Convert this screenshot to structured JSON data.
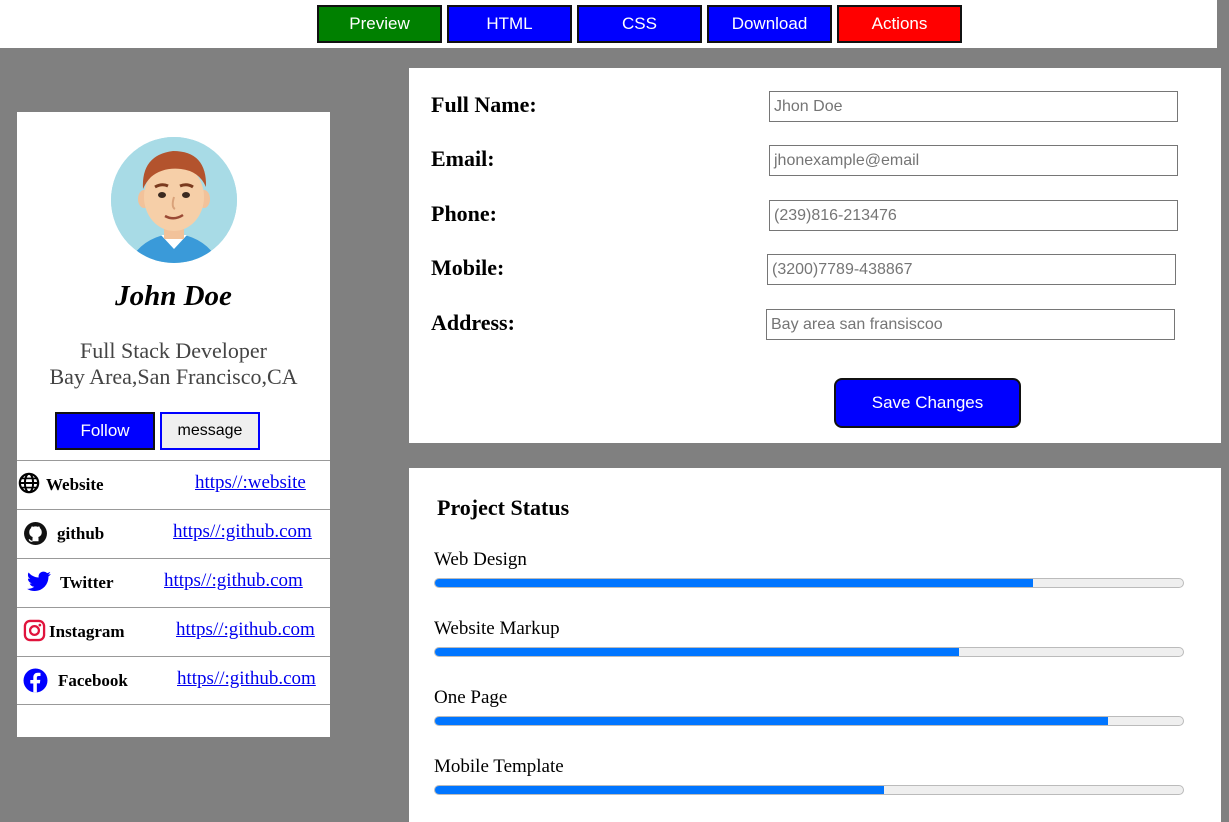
{
  "toolbar": {
    "buttons": [
      {
        "label": "Preview",
        "color": "#008000"
      },
      {
        "label": "HTML",
        "color": "#0000ff"
      },
      {
        "label": "CSS",
        "color": "#0000ff"
      },
      {
        "label": "Download",
        "color": "#0000ff"
      },
      {
        "label": "Actions",
        "color": "#ff0000"
      }
    ]
  },
  "profile": {
    "name": "John Doe",
    "role": "Full Stack Developer",
    "location": "Bay Area,San Francisco,CA",
    "follow_label": "Follow",
    "message_label": "message",
    "links": [
      {
        "label": "Website",
        "url": "https//:website",
        "icon": "globe-icon"
      },
      {
        "label": "github",
        "url": "https//:github.com",
        "icon": "github-icon"
      },
      {
        "label": "Twitter",
        "url": "https//:github.com",
        "icon": "twitter-icon"
      },
      {
        "label": "Instagram",
        "url": "https//:github.com",
        "icon": "instagram-icon"
      },
      {
        "label": "Facebook",
        "url": "https//:github.com",
        "icon": "facebook-icon"
      }
    ]
  },
  "form": {
    "fields": [
      {
        "label": "Full Name:",
        "placeholder": "Jhon Doe"
      },
      {
        "label": "Email:",
        "placeholder": "jhonexample@email"
      },
      {
        "label": "Phone:",
        "placeholder": "(239)816-213476"
      },
      {
        "label": "Mobile:",
        "placeholder": "(3200)7789-438867"
      },
      {
        "label": "Address:",
        "placeholder": "Bay area san fransiscoo"
      }
    ],
    "save_label": "Save Changes"
  },
  "project": {
    "title": "Project Status",
    "items": [
      {
        "label": "Web Design",
        "progress": 80
      },
      {
        "label": "Website Markup",
        "progress": 70
      },
      {
        "label": "One Page",
        "progress": 90
      },
      {
        "label": "Mobile Template",
        "progress": 60
      }
    ]
  },
  "colors": {
    "accent": "#0000ff",
    "progress": "#0075ff",
    "background": "#808080"
  }
}
